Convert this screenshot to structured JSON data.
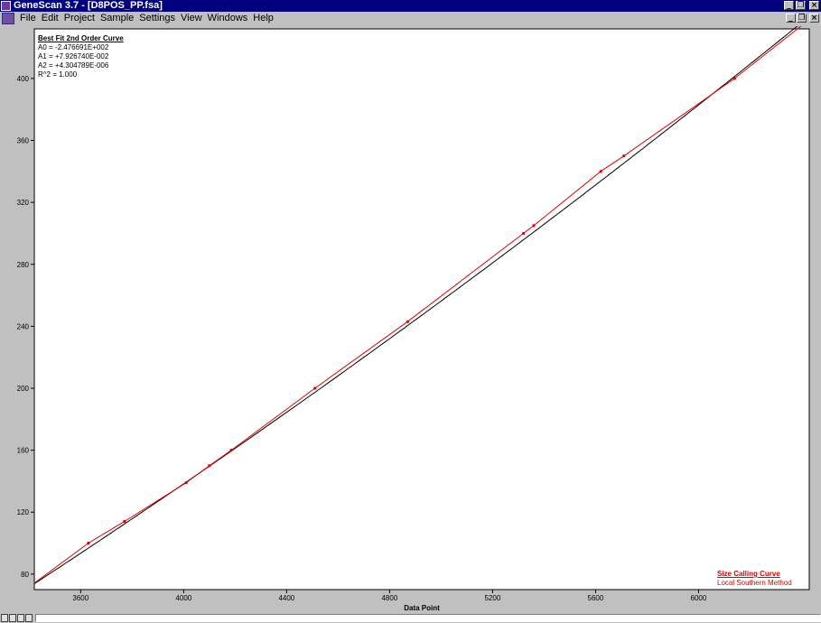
{
  "window": {
    "title": "GeneScan 3.7 - [D8POS_PP.fsa]",
    "controls": [
      "_",
      "❐",
      "×"
    ]
  },
  "menu": {
    "items": [
      {
        "label": "File",
        "key": "F"
      },
      {
        "label": "Edit",
        "key": "E"
      },
      {
        "label": "Project",
        "key": "P"
      },
      {
        "label": "Sample",
        "key": "S"
      },
      {
        "label": "Settings",
        "key": "t"
      },
      {
        "label": "View",
        "key": "V"
      },
      {
        "label": "Windows",
        "key": "W"
      },
      {
        "label": "Help",
        "key": "H"
      }
    ],
    "mdi_controls": [
      "_",
      "❐",
      "×"
    ]
  },
  "fit": {
    "header": "Best Fit 2nd Order Curve",
    "a0": "A0 = -2.476691E+002",
    "a1": "A1 = +7.926740E-002",
    "a2": "A2 = +4.304789E-006",
    "r2": "R^2 = 1.000"
  },
  "legend": {
    "line1": "Size Calling Curve",
    "line2": "Local Southern Method"
  },
  "chart_data": {
    "type": "scatter",
    "xlabel": "Data Point",
    "ylabel": "",
    "xlim": [
      3420,
      6430
    ],
    "ylim": [
      70,
      432
    ],
    "x_ticks": [
      3600,
      4000,
      4400,
      4800,
      5200,
      5600,
      6000
    ],
    "y_ticks": [
      80,
      120,
      160,
      200,
      240,
      280,
      320,
      360,
      400
    ],
    "fit_coefficients": {
      "a0": -247.6691,
      "a1": 0.0792674,
      "a2": 4.304789e-06
    },
    "series": [
      {
        "name": "Size Calling Curve",
        "color": "#e00000",
        "points": [
          [
            3630,
            100
          ],
          [
            3770,
            114
          ],
          [
            4010,
            139
          ],
          [
            4100,
            150
          ],
          [
            4185,
            160
          ],
          [
            4510,
            200
          ],
          [
            4870,
            243
          ],
          [
            5320,
            300
          ],
          [
            5360,
            305
          ],
          [
            5620,
            340
          ],
          [
            5710,
            350
          ],
          [
            6140,
            400
          ]
        ]
      }
    ],
    "grid": false,
    "colors": {
      "fit_line": "#000000",
      "curve": "#e00000",
      "axis": "#000000",
      "background": "#ffffff"
    }
  }
}
